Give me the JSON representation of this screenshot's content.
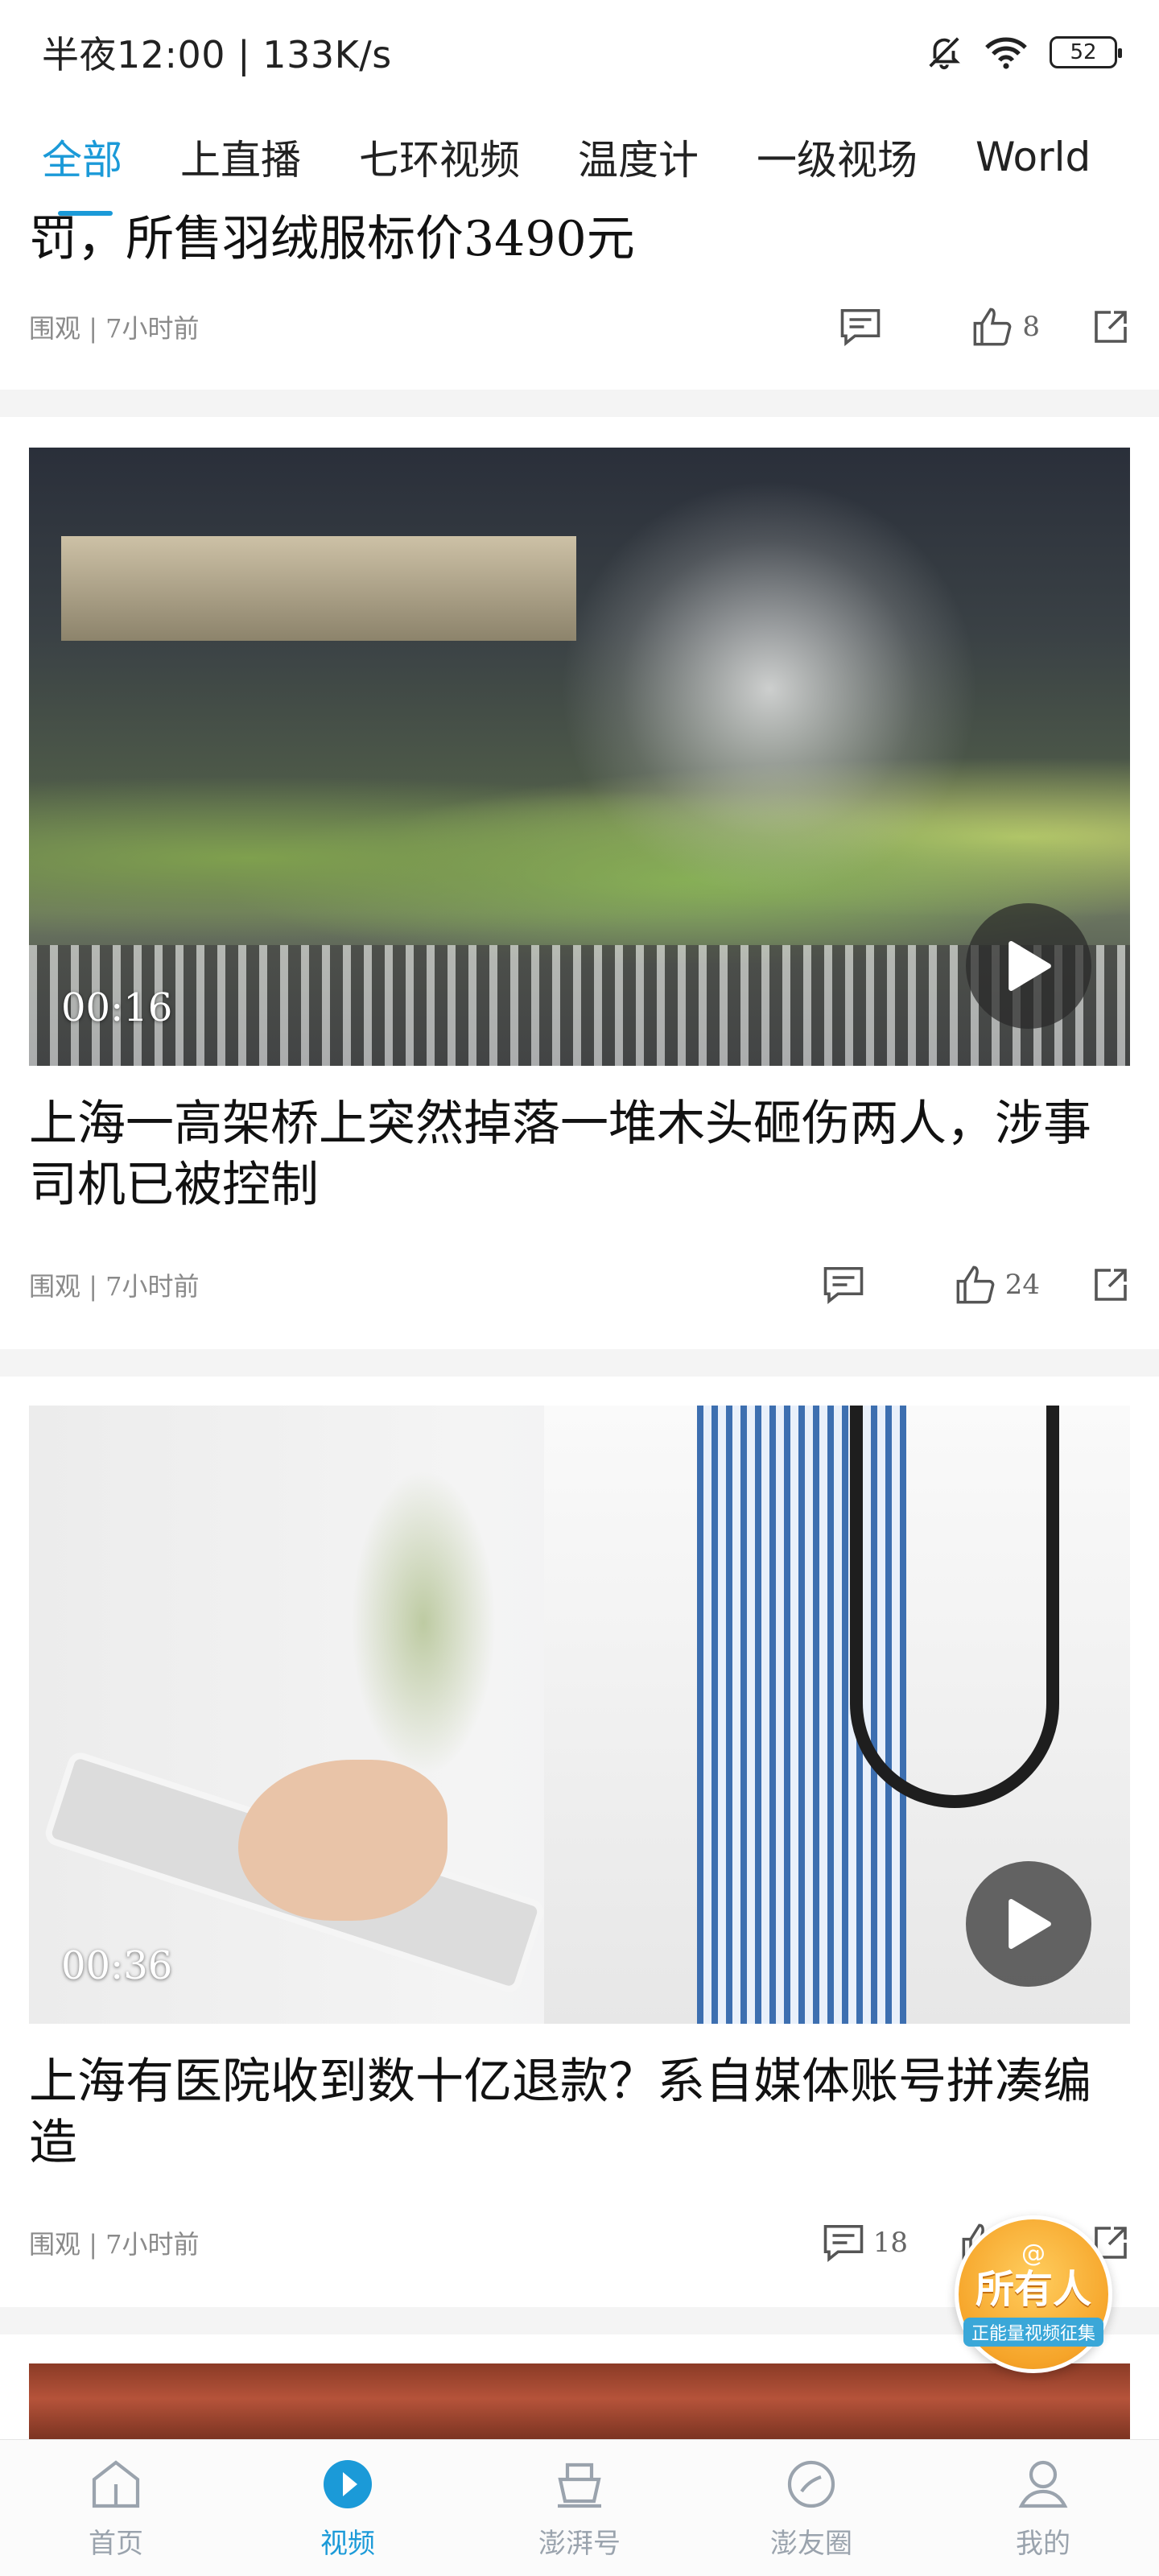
{
  "status_bar": {
    "time_speed": "半夜12:00 | 133K/s",
    "battery": "52",
    "icons": [
      "bell-off-icon",
      "wifi-icon",
      "battery-icon"
    ]
  },
  "tabs": [
    {
      "label": "全部",
      "active": true
    },
    {
      "label": "上直播",
      "active": false
    },
    {
      "label": "七环视频",
      "active": false
    },
    {
      "label": "温度计",
      "active": false
    },
    {
      "label": "一级视场",
      "active": false
    },
    {
      "label": "World",
      "active": false
    }
  ],
  "feed": [
    {
      "title": "罚，所售羽绒服标价3490元",
      "source": "围观",
      "time": "7小时前",
      "likes": "8",
      "comments": ""
    },
    {
      "title": "上海一高架桥上突然掉落一堆木头砸伤两人，涉事司机已被控制",
      "source": "围观",
      "time": "7小时前",
      "duration": "00:16",
      "likes": "24",
      "comments": ""
    },
    {
      "title": "上海有医院收到数十亿退款？系自媒体账号拼凑编造",
      "source": "围观",
      "time": "7小时前",
      "duration": "00:36",
      "likes": "",
      "comments": "18"
    }
  ],
  "badge": {
    "at": "@",
    "main": "所有人",
    "sub": "正能量视频征集"
  },
  "bottom_nav": [
    {
      "label": "首页",
      "icon": "home-icon",
      "active": false
    },
    {
      "label": "视频",
      "icon": "video-play-icon",
      "active": true
    },
    {
      "label": "澎湃号",
      "icon": "ship-icon",
      "active": false
    },
    {
      "label": "澎友圈",
      "icon": "chat-circle-icon",
      "active": false
    },
    {
      "label": "我的",
      "icon": "user-icon",
      "active": false
    }
  ],
  "colors": {
    "accent": "#1b9ad8",
    "meta_gray": "#8a8a8a"
  }
}
